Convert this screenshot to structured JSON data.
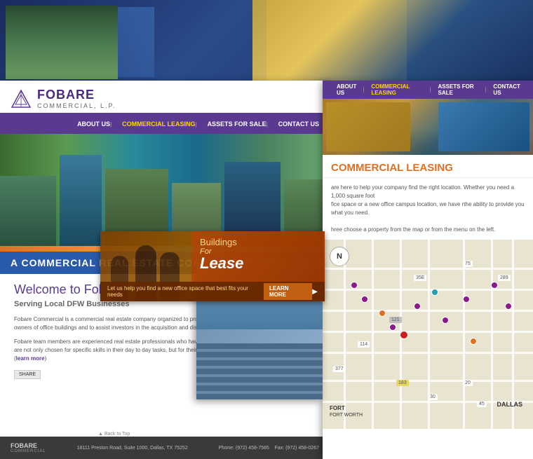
{
  "site": {
    "name": "FOBARE",
    "subtitle": "COMMERCIAL, L.P.",
    "tagline": "A COMMERCIAL REAL ESTATE COMPANY",
    "welcome_title": "Welcome to Fobare Commercial...",
    "serving": "Serving Local DFW Businesses",
    "desc1": "Fobare Commercial is a commercial real estate company organized to provide leasing and management services for owners of office buildings and to assist investors in the acquisition and disposition of real estate related investments.",
    "desc2": "Fobare team members are experienced real estate professionals who have worked together since 1989. Team members are not only chosen for specific skills in their day to day tasks, but for their overall knowledge of real estate business.",
    "learn_more": "learn more",
    "back_to_top": "▲ Back to Top",
    "footer_address": "18111 Preston Road, Suite 1000, Dallas, TX 75252",
    "footer_phone": "Phone: (972) 458-7585",
    "footer_fax": "Fax: (972) 458-0267"
  },
  "nav": {
    "items": [
      "ABOUT US",
      "COMMERCIAL LEASING",
      "ASSETS FOR SALE",
      "CONTACT US"
    ]
  },
  "lease_banner": {
    "buildings": "Buildings",
    "for": "For",
    "lease": "Lease",
    "subtitle": "Let us help you find a new office space that best fits your needs",
    "cta": "LEARN MORE"
  },
  "commercial_leasing": {
    "title": "COMMERCIAL LEASING",
    "text1": "are here to help your company find the right location. Whether you need a 1,000 square foot",
    "text2": "fice space or a new office campus location, we have rthe ability to provide you what you need.",
    "text3": "hree choose a property from the map or from the menu on the left."
  },
  "map": {
    "compass": "N",
    "dallas_label": "DALLAS",
    "fort_worth_label": "FORT\nWorth"
  },
  "colors": {
    "purple": "#5a3a90",
    "orange": "#e07020",
    "teal": "#20a0b0",
    "dark_bg": "#2a3a5c"
  }
}
